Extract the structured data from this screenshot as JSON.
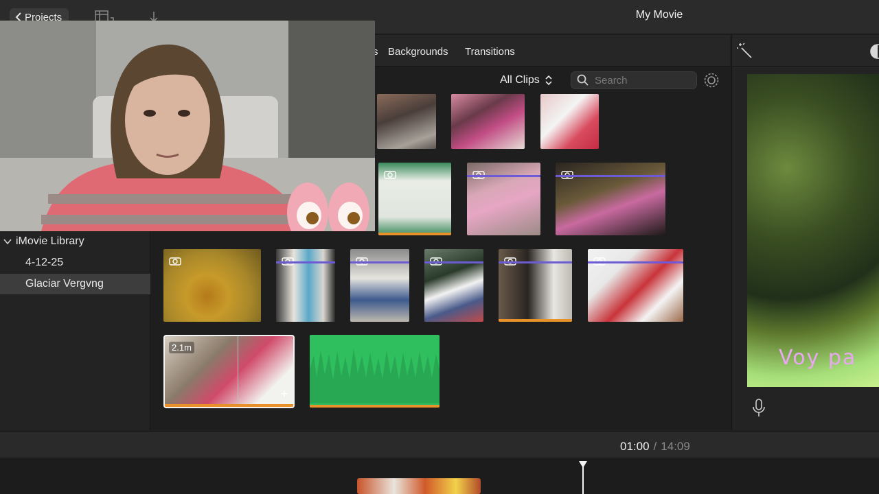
{
  "toolbar": {
    "projects_label": "Projects",
    "movie_title": "My Movie"
  },
  "browser": {
    "tabs": [
      "s",
      "Backgrounds",
      "Transitions"
    ],
    "filter_label": "All Clips",
    "search_placeholder": "Search"
  },
  "library": {
    "title": "iMovie Library",
    "events": [
      "4-12-25",
      "Glaciar Vergvng"
    ]
  },
  "clips": {
    "selected_duration": "2.1m"
  },
  "viewer": {
    "overlay_text": "Voy pa"
  },
  "playback": {
    "current_time": "01:00",
    "separator": "/",
    "total_time": "14:09"
  },
  "icons": [
    "chevron-left-icon",
    "clapper-icon",
    "import-icon",
    "magic-wand-icon",
    "color-icon",
    "sort-chevrons-icon",
    "search-icon",
    "gear-icon",
    "camera-icon",
    "plus-icon",
    "microphone-icon",
    "disclosure-icon",
    "playhead-icon"
  ],
  "colors": {
    "accent_orange": "#e8902a",
    "keyword_purple": "#6b5bd6",
    "audio_green": "#2fbf5e",
    "selection_white": "#f4f4f4"
  }
}
